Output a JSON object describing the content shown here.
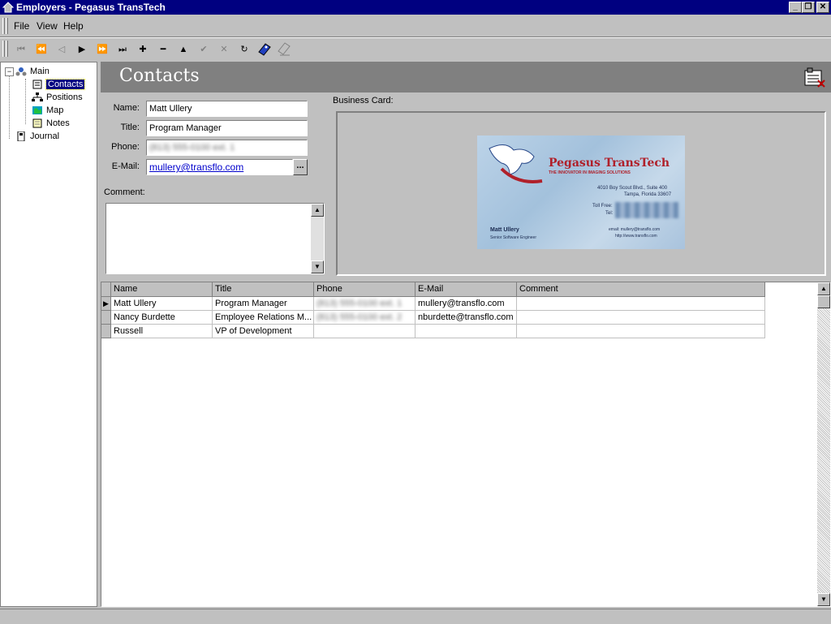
{
  "window": {
    "title": "Employers - Pegasus TransTech"
  },
  "menu": {
    "file": "File",
    "view": "View",
    "help": "Help"
  },
  "toolbar": {
    "first": "⏮",
    "prev_page": "⏪",
    "prev": "◁",
    "next": "▶",
    "next_page": "⏩",
    "last": "⏭",
    "insert": "✚",
    "delete": "━",
    "edit": "▲",
    "post": "✔",
    "cancel": "✕",
    "refresh": "↻"
  },
  "nav": {
    "main": "Main",
    "items": [
      {
        "label": "Contacts",
        "icon": "contacts-icon"
      },
      {
        "label": "Positions",
        "icon": "positions-icon"
      },
      {
        "label": "Map",
        "icon": "map-icon"
      },
      {
        "label": "Notes",
        "icon": "notes-icon"
      }
    ],
    "journal": "Journal"
  },
  "header": {
    "title": "Contacts"
  },
  "form": {
    "name_label": "Name:",
    "name_value": "Matt Ullery",
    "title_label": "Title:",
    "title_value": "Program Manager",
    "phone_label": "Phone:",
    "phone_value": "(813) 555-0100 ext. 1",
    "email_label": "E-Mail:",
    "email_value": "mullery@transflo.com",
    "ellipsis": "...",
    "comment_label": "Comment:",
    "business_card_label": "Business Card:"
  },
  "business_card": {
    "company": "Pegasus TransTech",
    "tagline": "THE INNOVATOR IN IMAGING SOLUTIONS",
    "address1": "4010 Boy Scout Blvd., Suite 400",
    "address2": "Tampa, Florida 33607",
    "tollfree": "Toll Free:",
    "tel": "Tel:",
    "person": "Matt Ullery",
    "role": "Senior Software Engineer",
    "email": "email: mullery@transflo.com",
    "web": "http://www.transflo.com"
  },
  "grid": {
    "columns": [
      "Name",
      "Title",
      "Phone",
      "E-Mail",
      "Comment"
    ],
    "rows": [
      {
        "name": "Matt Ullery",
        "title": "Program Manager",
        "phone": "(813) 555-0100 ext. 1",
        "email": "mullery@transflo.com",
        "comment": ""
      },
      {
        "name": "Nancy Burdette",
        "title": "Employee Relations M...",
        "phone": "(813) 555-0100 ext. 2",
        "email": "nburdette@transflo.com",
        "comment": ""
      },
      {
        "name": "Russell",
        "title": "VP of Development",
        "phone": "",
        "email": "",
        "comment": ""
      }
    ]
  },
  "colors": {
    "titlebar": "#000080",
    "face": "#c0c0c0",
    "header": "#808080",
    "link": "#0000cc"
  }
}
